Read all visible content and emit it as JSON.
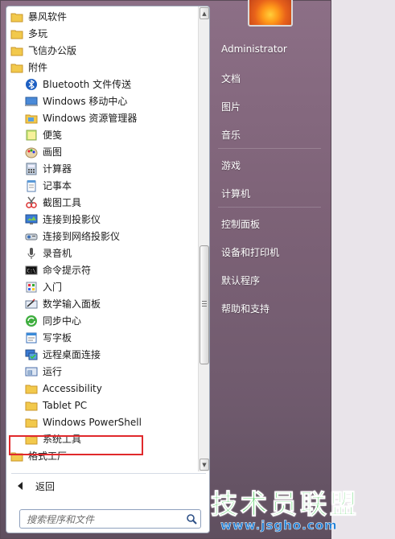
{
  "left_list": {
    "items": [
      {
        "label": "暴风软件",
        "icon": "folder-icon"
      },
      {
        "label": "多玩",
        "icon": "folder-icon"
      },
      {
        "label": "飞信办公版",
        "icon": "folder-icon"
      },
      {
        "label": "附件",
        "icon": "folder-icon"
      },
      {
        "label": "Bluetooth 文件传送",
        "icon": "bluetooth-icon"
      },
      {
        "label": "Windows 移动中心",
        "icon": "mobility-center-icon"
      },
      {
        "label": "Windows 资源管理器",
        "icon": "explorer-folder-icon"
      },
      {
        "label": "便笺",
        "icon": "sticky-notes-icon"
      },
      {
        "label": "画图",
        "icon": "paint-palette-icon"
      },
      {
        "label": "计算器",
        "icon": "calculator-icon"
      },
      {
        "label": "记事本",
        "icon": "notepad-icon"
      },
      {
        "label": "截图工具",
        "icon": "scissors-icon"
      },
      {
        "label": "连接到投影仪",
        "icon": "monitor-icon"
      },
      {
        "label": "连接到网络投影仪",
        "icon": "network-projector-icon"
      },
      {
        "label": "录音机",
        "icon": "microphone-icon"
      },
      {
        "label": "命令提示符",
        "icon": "command-prompt-icon"
      },
      {
        "label": "入门",
        "icon": "getting-started-icon"
      },
      {
        "label": "数学输入面板",
        "icon": "math-input-icon"
      },
      {
        "label": "同步中心",
        "icon": "sync-icon"
      },
      {
        "label": "写字板",
        "icon": "wordpad-icon"
      },
      {
        "label": "远程桌面连接",
        "icon": "remote-desktop-icon"
      },
      {
        "label": "运行",
        "icon": "run-icon"
      },
      {
        "label": "Accessibility",
        "icon": "folder-icon"
      },
      {
        "label": "Tablet PC",
        "icon": "folder-icon"
      },
      {
        "label": "Windows PowerShell",
        "icon": "folder-icon"
      },
      {
        "label": "系统工具",
        "icon": "folder-icon"
      },
      {
        "label": "格式工厂",
        "icon": "folder-icon"
      }
    ]
  },
  "back_label": "返回",
  "search": {
    "placeholder": "搜索程序和文件"
  },
  "right_menu": {
    "items": [
      "Administrator",
      "文档",
      "图片",
      "音乐",
      "游戏",
      "计算机",
      "控制面板",
      "设备和打印机",
      "默认程序",
      "帮助和支持"
    ]
  },
  "watermark": {
    "title": "技术员联盟",
    "url": "www.jsgho.com"
  },
  "colors": {
    "highlight_border": "#e0292c",
    "watermark_green": "#25c23a",
    "watermark_blue": "#1f7fd6"
  }
}
